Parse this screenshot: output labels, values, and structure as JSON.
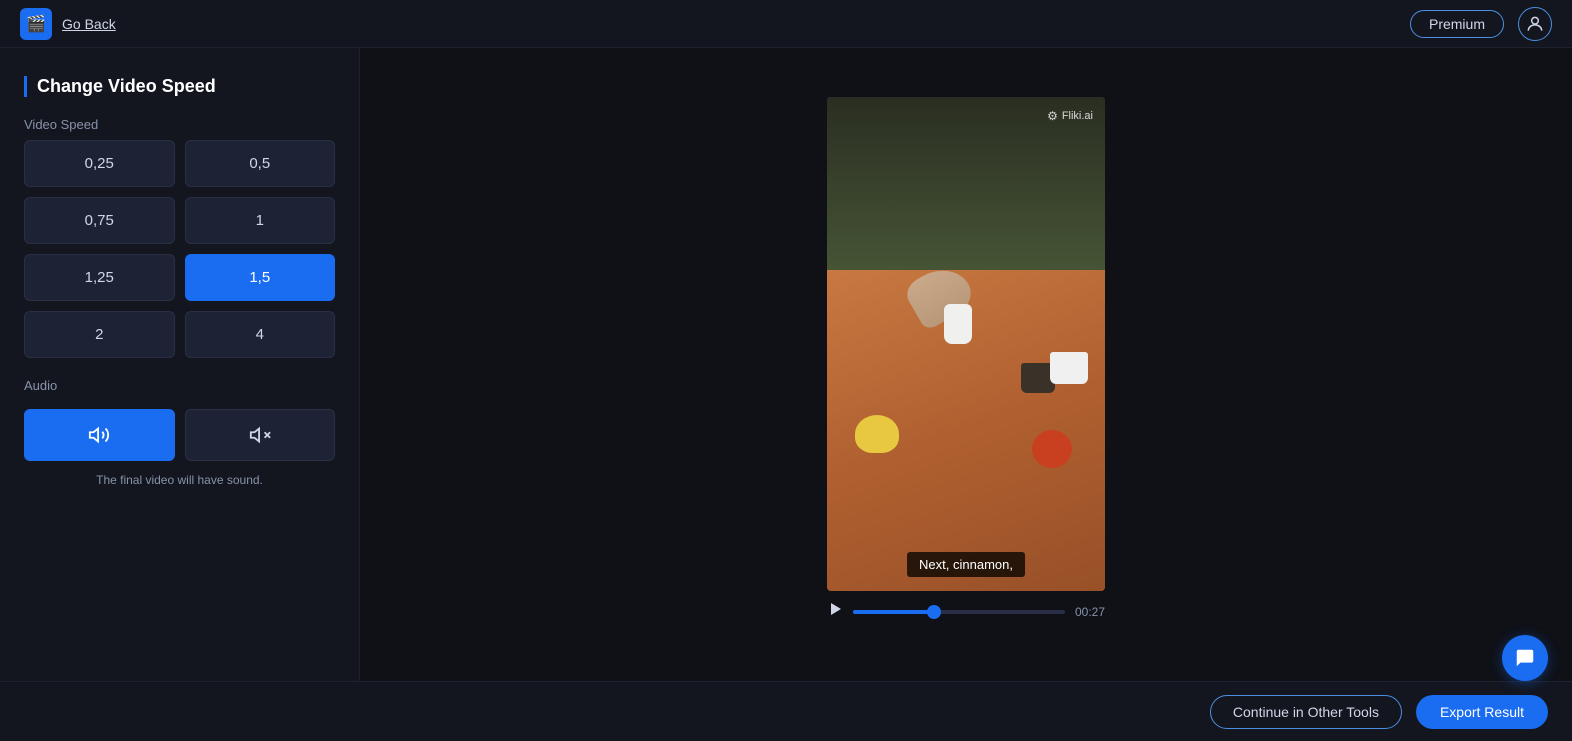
{
  "header": {
    "app_icon": "🎬",
    "go_back_label": "Go Back",
    "premium_label": "Premium"
  },
  "sidebar": {
    "title": "Change Video Speed",
    "video_speed_label": "Video Speed",
    "speed_options": [
      {
        "value": "0,25",
        "active": false
      },
      {
        "value": "0,5",
        "active": false
      },
      {
        "value": "0,75",
        "active": false
      },
      {
        "value": "1",
        "active": false
      },
      {
        "value": "1,25",
        "active": false
      },
      {
        "value": "1,5",
        "active": true
      },
      {
        "value": "2",
        "active": false
      },
      {
        "value": "4",
        "active": false
      }
    ],
    "audio_label": "Audio",
    "audio_note": "The final video will have sound."
  },
  "video": {
    "watermark": "Fliki.ai",
    "subtitle": "Next, cinnamon,",
    "progress_percent": 38,
    "time_display": "00:27"
  },
  "footer": {
    "continue_label": "Continue in Other Tools",
    "export_label": "Export Result"
  },
  "chat": {
    "icon": "💬"
  }
}
